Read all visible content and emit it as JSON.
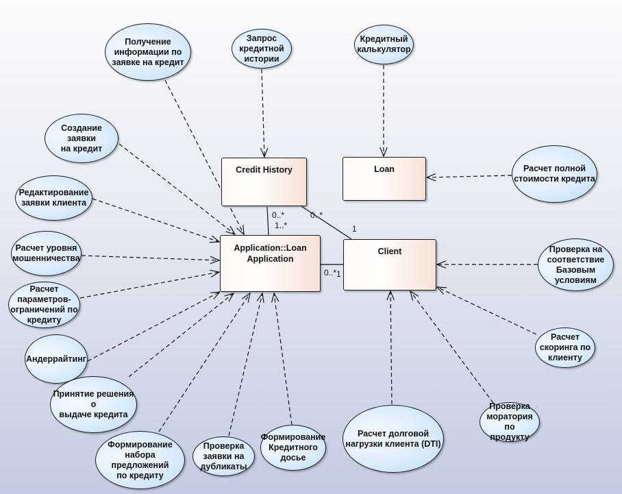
{
  "diagram": {
    "type": "UML use case / class diagram",
    "classes": [
      {
        "id": "credit_history",
        "label": "Credit History"
      },
      {
        "id": "loan",
        "label": "Loan"
      },
      {
        "id": "loan_application",
        "label": "Application::Loan\nApplication"
      },
      {
        "id": "client",
        "label": "Client"
      }
    ],
    "use_cases": [
      {
        "id": "uc_info",
        "label": "Получение\nинформации по\nзаявке на кредит",
        "target": "loan_application"
      },
      {
        "id": "uc_history_request",
        "label": "Запрос\nкредитной\nистории",
        "target": "credit_history"
      },
      {
        "id": "uc_calculator",
        "label": "Кредитный\nкалькулятор",
        "target": "loan"
      },
      {
        "id": "uc_create",
        "label": "Создание заявки\nна кредит",
        "target": "loan_application"
      },
      {
        "id": "uc_edit",
        "label": "Редактирование\nзаявки клиента",
        "target": "loan_application"
      },
      {
        "id": "uc_fraud",
        "label": "Расчет уровня\nмошенничества",
        "target": "loan_application"
      },
      {
        "id": "uc_limits",
        "label": "Расчет\nпараметров-\nограничений по\nкредиту",
        "target": "loan_application"
      },
      {
        "id": "uc_underwriting",
        "label": "Андеррайтинг",
        "target": "loan_application"
      },
      {
        "id": "uc_decision",
        "label": "Принятие решения о\nвыдаче кредита",
        "target": "loan_application"
      },
      {
        "id": "uc_offers",
        "label": "Формирование\nнабора предложений\nпо кредиту",
        "target": "loan_application"
      },
      {
        "id": "uc_duplicates",
        "label": "Проверка\nзаявки на\nдубликаты",
        "target": "loan_application"
      },
      {
        "id": "uc_dossier",
        "label": "Формирование\nКредитного\nдосье",
        "target": "loan_application"
      },
      {
        "id": "uc_dti",
        "label": "Расчет долговой\nнагрузки клиента (DTI)",
        "target": "client"
      },
      {
        "id": "uc_moratorium",
        "label": "Проверка\nморатория по\nпродукту",
        "target": "client"
      },
      {
        "id": "uc_scoring",
        "label": "Расчет\nскоринга по\nклиенту",
        "target": "client"
      },
      {
        "id": "uc_base_conditions",
        "label": "Проверка на\nсоответствие\nБазовым\nусловиям",
        "target": "client"
      },
      {
        "id": "uc_full_cost",
        "label": "Расчет полной\nстоимости кредита",
        "target": "loan"
      }
    ],
    "associations": [
      {
        "from": "credit_history",
        "to": "loan_application",
        "from_mult": "0..*",
        "to_mult": "1..*"
      },
      {
        "from": "credit_history",
        "to": "client",
        "from_mult": "0..*",
        "to_mult": "1"
      },
      {
        "from": "loan_application",
        "to": "client",
        "from_mult": "0..*",
        "to_mult": "1"
      }
    ]
  }
}
